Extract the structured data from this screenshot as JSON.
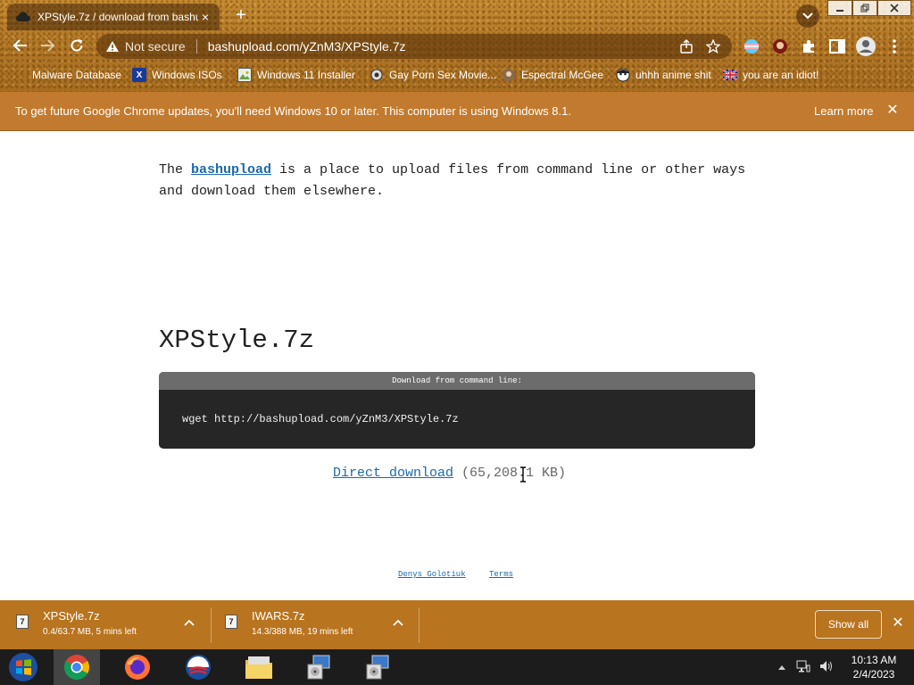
{
  "tab": {
    "title": "XPStyle.7z / download from bashu",
    "favicon": "cloud-icon",
    "close": "×"
  },
  "new_tab": "+",
  "toolbar": {
    "security_label": "Not secure",
    "url": "bashupload.com/yZnM3/XPStyle.7z"
  },
  "bookmarks": [
    {
      "label": "Malware Database",
      "icon": "folder-icon",
      "color": "#3a2a10"
    },
    {
      "label": "Windows ISOs",
      "icon": "x-icon",
      "color": "#1a3a9a"
    },
    {
      "label": "Windows 11 Installer",
      "icon": "image-icon",
      "color": "#6aa04a"
    },
    {
      "label": "Gay Porn Sex Movie...",
      "icon": "gear-icon",
      "color": "#333333"
    },
    {
      "label": "Espectral McGee",
      "icon": "avatar-icon",
      "color": "#8a6a4a"
    },
    {
      "label": "uhhh anime shit",
      "icon": "face-icon",
      "color": "#222222"
    },
    {
      "label": "you are an idiot!",
      "icon": "flag-icon",
      "color": "#c8102e"
    }
  ],
  "infobar": {
    "message": "To get future Google Chrome updates, you'll need Windows 10 or later. This computer is using Windows 8.1.",
    "learn_more": "Learn more",
    "close": "✕"
  },
  "page": {
    "intro_prefix": "The ",
    "intro_link": "bashupload",
    "intro_suffix": " is a place to upload files from command line or other ways and download them elsewhere.",
    "filename": "XPStyle.7z",
    "cmd_header": "Download from command line:",
    "cmd": "wget http://bashupload.com/yZnM3/XPStyle.7z",
    "direct_download": "Direct download",
    "size": " (65,208.1 KB)",
    "footer_author": "Denys Golotiuk",
    "footer_terms": "Terms"
  },
  "downloads": [
    {
      "name": "XPStyle.7z",
      "status": "0.4/63.7 MB, 5 mins left"
    },
    {
      "name": "IWARS.7z",
      "status": "14.3/388 MB, 19 mins left"
    }
  ],
  "shelf": {
    "show_all": "Show all",
    "close": "✕"
  },
  "taskbar": {
    "apps": [
      "start-button",
      "chrome-icon",
      "firefox-icon",
      "obama-icon",
      "file-explorer-icon",
      "installer-icon",
      "installer-icon"
    ],
    "time": "10:13 AM",
    "date": "2/4/2023"
  },
  "colors": {
    "link": "#1a6aa8",
    "chrome_wood": "#b47a26",
    "infobar": "#c27a2e",
    "shelf": "#b8741e",
    "cmd_bg": "#262626"
  }
}
